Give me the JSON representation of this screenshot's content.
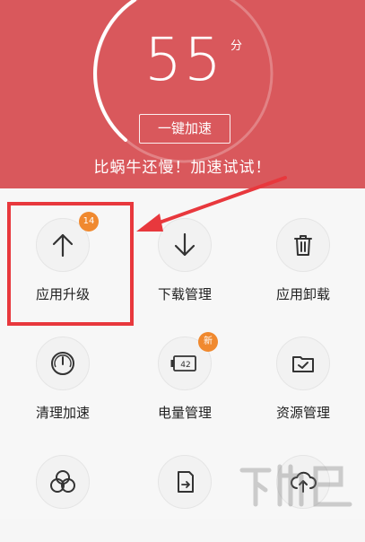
{
  "score": {
    "value": "55",
    "unit": "分"
  },
  "boost_button": "一键加速",
  "slogan": "比蜗牛还慢！加速试试！",
  "tools": [
    {
      "label": "应用升级",
      "badge": "14"
    },
    {
      "label": "下载管理"
    },
    {
      "label": "应用卸载"
    },
    {
      "label": "清理加速"
    },
    {
      "label": "电量管理",
      "badge": "新",
      "battery": "42"
    },
    {
      "label": "资源管理"
    }
  ],
  "colors": {
    "header": "#d9585c",
    "badge": "#f0892f",
    "highlight": "#e8383d"
  }
}
